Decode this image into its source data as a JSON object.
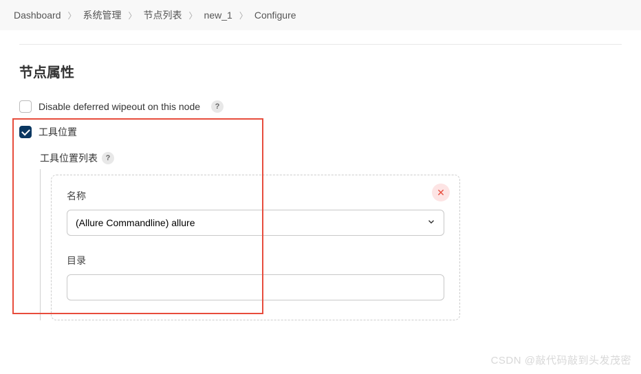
{
  "breadcrumb": {
    "items": [
      {
        "label": "Dashboard"
      },
      {
        "label": "系统管理"
      },
      {
        "label": "节点列表"
      },
      {
        "label": "new_1"
      },
      {
        "label": "Configure"
      }
    ]
  },
  "section": {
    "title": "节点属性"
  },
  "options": {
    "disable_wipeout": {
      "label": "Disable deferred wipeout on this node",
      "checked": false
    },
    "tool_location": {
      "label": "工具位置",
      "checked": true
    }
  },
  "tool_list": {
    "label": "工具位置列表",
    "item": {
      "name_label": "名称",
      "name_value": "(Allure Commandline) allure",
      "dir_label": "目录",
      "dir_value": ""
    }
  },
  "icons": {
    "help": "?",
    "close": "✕"
  },
  "watermark": "CSDN @敲代码敲到头发茂密"
}
